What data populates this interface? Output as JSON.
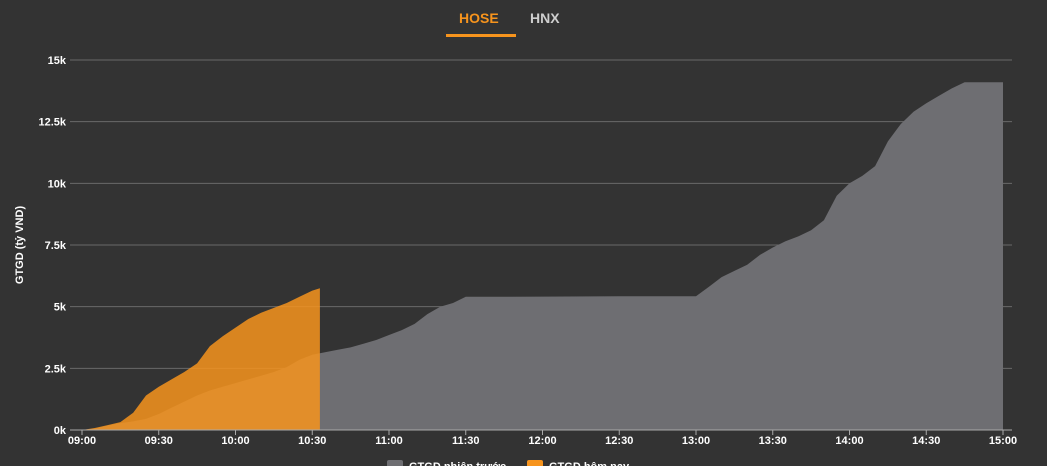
{
  "tabs": [
    {
      "label": "HOSE",
      "active": true
    },
    {
      "label": "HNX",
      "active": false
    }
  ],
  "colors": {
    "background": "#333333",
    "accent": "#f7941d",
    "series_prev": "#6e6e72",
    "series_today": "#f7941d"
  },
  "chart_data": {
    "type": "area",
    "ylabel": "GTGD (tỷ VND)",
    "xlabel": "",
    "y_ticks": [
      "0k",
      "2.5k",
      "5k",
      "7.5k",
      "10k",
      "12.5k",
      "15k"
    ],
    "ylim": [
      0,
      15000
    ],
    "x_ticks": [
      "09:00",
      "09:30",
      "10:00",
      "10:30",
      "11:00",
      "11:30",
      "12:00",
      "12:30",
      "13:00",
      "13:30",
      "14:00",
      "14:30",
      "15:00"
    ],
    "xlim": [
      "09:00",
      "15:00"
    ],
    "grid": true,
    "legend_position": "bottom",
    "series": [
      {
        "name": "GTGD phiên trước",
        "color": "#6e6e72",
        "points": [
          [
            "09:00",
            0
          ],
          [
            "09:05",
            60
          ],
          [
            "09:10",
            180
          ],
          [
            "09:15",
            280
          ],
          [
            "09:20",
            350
          ],
          [
            "09:25",
            450
          ],
          [
            "09:30",
            650
          ],
          [
            "09:35",
            900
          ],
          [
            "09:40",
            1150
          ],
          [
            "09:45",
            1400
          ],
          [
            "09:50",
            1600
          ],
          [
            "09:55",
            1750
          ],
          [
            "10:00",
            1900
          ],
          [
            "10:05",
            2050
          ],
          [
            "10:10",
            2200
          ],
          [
            "10:15",
            2350
          ],
          [
            "10:20",
            2550
          ],
          [
            "10:25",
            2850
          ],
          [
            "10:30",
            3050
          ],
          [
            "10:35",
            3150
          ],
          [
            "10:40",
            3250
          ],
          [
            "10:45",
            3350
          ],
          [
            "10:50",
            3500
          ],
          [
            "10:55",
            3650
          ],
          [
            "11:00",
            3850
          ],
          [
            "11:05",
            4050
          ],
          [
            "11:10",
            4300
          ],
          [
            "11:15",
            4700
          ],
          [
            "11:20",
            5000
          ],
          [
            "11:25",
            5150
          ],
          [
            "11:30",
            5400
          ],
          [
            "11:45",
            5400
          ],
          [
            "12:00",
            5410
          ],
          [
            "12:30",
            5420
          ],
          [
            "13:00",
            5420
          ],
          [
            "13:05",
            5800
          ],
          [
            "13:10",
            6200
          ],
          [
            "13:15",
            6450
          ],
          [
            "13:20",
            6700
          ],
          [
            "13:25",
            7100
          ],
          [
            "13:30",
            7400
          ],
          [
            "13:35",
            7650
          ],
          [
            "13:40",
            7850
          ],
          [
            "13:45",
            8100
          ],
          [
            "13:50",
            8500
          ],
          [
            "13:55",
            9500
          ],
          [
            "14:00",
            10000
          ],
          [
            "14:05",
            10300
          ],
          [
            "14:10",
            10700
          ],
          [
            "14:15",
            11700
          ],
          [
            "14:20",
            12400
          ],
          [
            "14:25",
            12900
          ],
          [
            "14:30",
            13250
          ],
          [
            "14:35",
            13550
          ],
          [
            "14:40",
            13850
          ],
          [
            "14:45",
            14100
          ],
          [
            "15:00",
            14100
          ]
        ]
      },
      {
        "name": "GTGD hôm nay",
        "color": "#f7941d",
        "points": [
          [
            "09:00",
            0
          ],
          [
            "09:05",
            80
          ],
          [
            "09:10",
            200
          ],
          [
            "09:15",
            320
          ],
          [
            "09:20",
            700
          ],
          [
            "09:25",
            1400
          ],
          [
            "09:30",
            1750
          ],
          [
            "09:35",
            2050
          ],
          [
            "09:40",
            2350
          ],
          [
            "09:45",
            2700
          ],
          [
            "09:50",
            3400
          ],
          [
            "09:55",
            3800
          ],
          [
            "10:00",
            4150
          ],
          [
            "10:05",
            4500
          ],
          [
            "10:10",
            4750
          ],
          [
            "10:15",
            4950
          ],
          [
            "10:20",
            5150
          ],
          [
            "10:25",
            5400
          ],
          [
            "10:30",
            5650
          ],
          [
            "10:33",
            5750
          ]
        ]
      }
    ]
  }
}
